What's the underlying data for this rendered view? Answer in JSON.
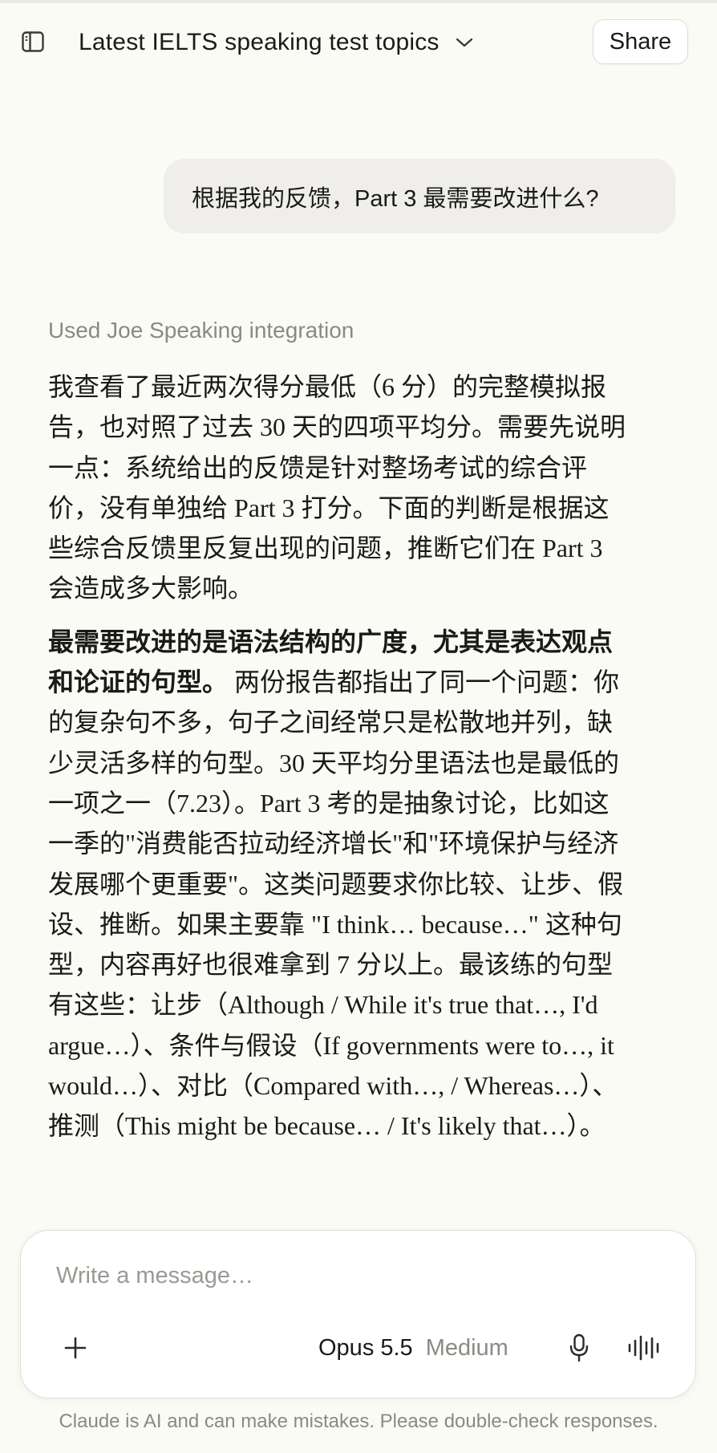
{
  "header": {
    "title": "Latest IELTS speaking test topics",
    "share_label": "Share",
    "sidebar_icon": "sidebar-panel-icon",
    "title_chevron_icon": "chevron-down-icon"
  },
  "conversation": {
    "user_message": "根据我的反馈，Part 3 最需要改进什么?",
    "tool_use_label": "Used Joe Speaking integration",
    "assistant": {
      "paragraph1": "我查看了最近两次得分最低（6 分）的完整模拟报告，也对照了过去 30 天的四项平均分。需要先说明一点：系统给出的反馈是针对整场考试的综合评价，没有单独给 Part 3 打分。下面的判断是根据这些综合反馈里反复出现的问题，推断它们在 Part 3 会造成多大影响。",
      "paragraph2_bold": "最需要改进的是语法结构的广度，尤其是表达观点和论证的句型。",
      "paragraph2_text": " 两份报告都指出了同一个问题：你的复杂句不多，句子之间经常只是松散地并列，缺少灵活多样的句型。30 天平均分里语法也是最低的一项之一（7.23）。Part 3 考的是抽象讨论，比如这一季的\"消费能否拉动经济增长\"和\"环境保护与经济发展哪个更重要\"。这类问题要求你比较、让步、假设、推断。如果主要靠 \"I think… because…\" 这种句型，内容再好也很难拿到 7 分以上。最该练的句型有这些：让步（Although / While it's true that…, I'd argue…）、条件与假设（If governments were to…, it would…）、对比（Compared with…, / Whereas…）、推测（This might be because… / It's likely that…）。"
    }
  },
  "composer": {
    "placeholder": "Write a message…",
    "model_name": "Opus 5.5",
    "effort_level": "Medium",
    "add_icon": "plus-icon",
    "mic_icon": "microphone-icon",
    "voice_icon": "voice-waveform-icon"
  },
  "footer": {
    "disclaimer": "Claude is AI and can make mistakes. Please double-check responses."
  },
  "colors": {
    "background": "#fbfbf6",
    "user_bubble": "#efeeea",
    "muted_text": "#8a8a84",
    "primary_text": "#1a1a18"
  }
}
